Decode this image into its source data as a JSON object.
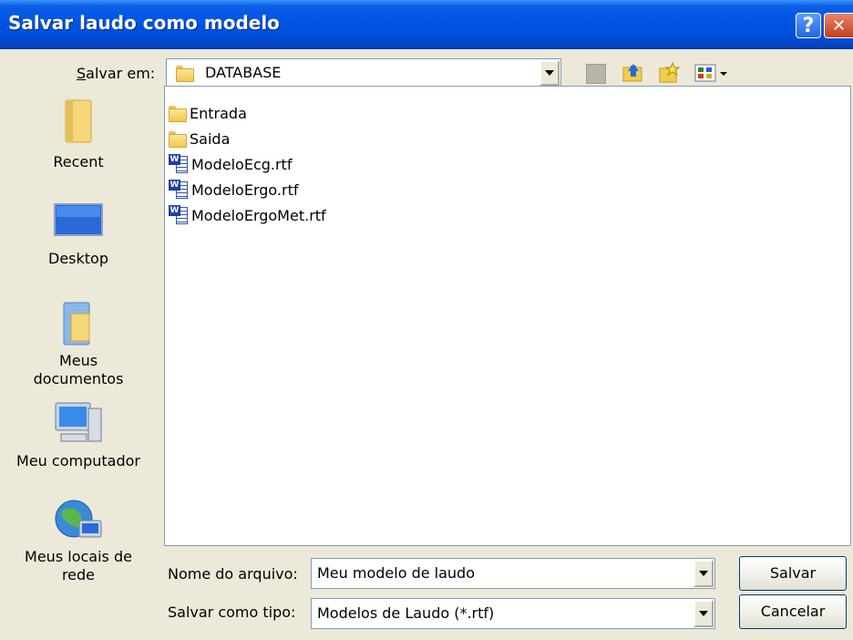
{
  "window": {
    "title": "Salvar laudo como modelo"
  },
  "titlebar": {
    "help": "?",
    "close": "✕"
  },
  "save_in": {
    "label": "Salvar em:",
    "value": "DATABASE"
  },
  "places": [
    {
      "label": "Recent",
      "icon": "recent-documents-icon"
    },
    {
      "label": "Desktop",
      "icon": "desktop-icon"
    },
    {
      "label1": "Meus",
      "label2": "documentos",
      "icon": "my-documents-icon"
    },
    {
      "label": "Meu computador",
      "icon": "my-computer-icon"
    },
    {
      "label1": "Meus locais de",
      "label2": "rede",
      "icon": "network-places-icon"
    }
  ],
  "files": [
    {
      "name": "Entrada",
      "icon": "folder-icon"
    },
    {
      "name": "Saida",
      "icon": "folder-icon"
    },
    {
      "name": "ModeloEcg.rtf",
      "icon": "word-document-icon"
    },
    {
      "name": "ModeloErgo.rtf",
      "icon": "word-document-icon"
    },
    {
      "name": "ModeloErgoMet.rtf",
      "icon": "word-document-icon"
    }
  ],
  "filename": {
    "label": "Nome do arquivo:",
    "value": "Meu modelo de laudo"
  },
  "filetype": {
    "label": "Salvar como tipo:",
    "value": "Modelos de Laudo (*.rtf)"
  },
  "buttons": {
    "save": "Salvar",
    "cancel": "Cancelar"
  }
}
